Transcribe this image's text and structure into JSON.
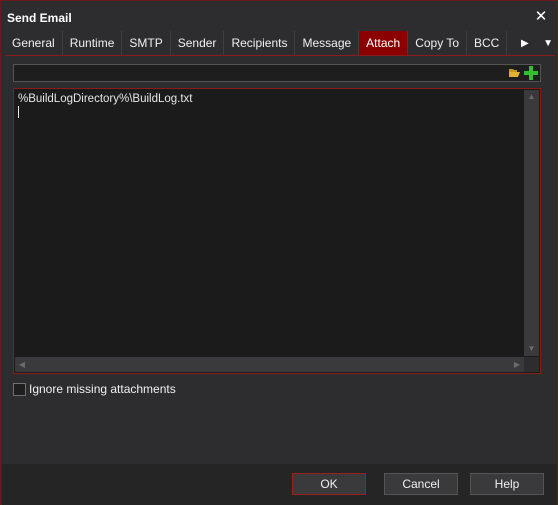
{
  "window": {
    "title": "Send Email"
  },
  "tabs": [
    {
      "label": "General"
    },
    {
      "label": "Runtime"
    },
    {
      "label": "SMTP"
    },
    {
      "label": "Sender"
    },
    {
      "label": "Recipients"
    },
    {
      "label": "Message"
    },
    {
      "label": "Attach",
      "active": true
    },
    {
      "label": "Copy To"
    },
    {
      "label": "BCC"
    }
  ],
  "attach": {
    "path_value": "",
    "attachments_text": "%BuildLogDirectory%\\BuildLog.txt",
    "ignore_missing_label": "Ignore missing attachments",
    "ignore_missing_checked": false
  },
  "buttons": {
    "ok": "OK",
    "cancel": "Cancel",
    "help": "Help"
  },
  "colors": {
    "accent": "#8b0000",
    "background": "#2d2d30",
    "add_icon": "#2fbf2f",
    "folder_icon": "#e0b030"
  },
  "icons": {
    "close": "close-icon",
    "tab_scroll_right": "chevron-right-icon",
    "tab_menu": "menu-down-icon",
    "browse": "folder-icon",
    "add": "plus-icon"
  }
}
